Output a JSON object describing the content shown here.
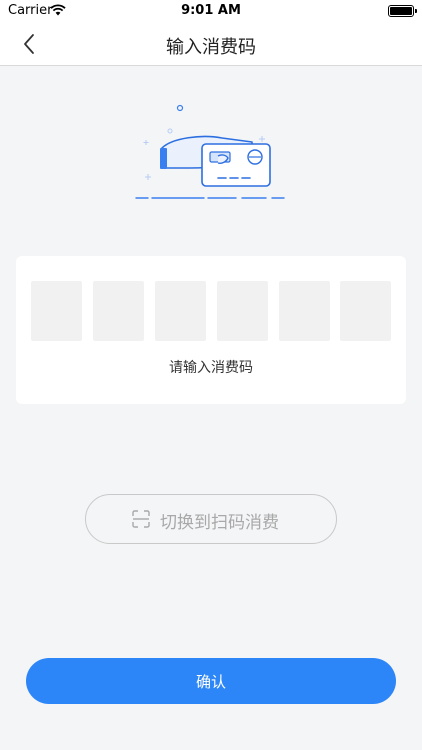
{
  "status_bar": {
    "carrier": "Carrier",
    "time": "9:01 AM"
  },
  "nav": {
    "title": "输入消费码",
    "back_icon": "chevron-left-icon"
  },
  "illustration_icon": "hand-holding-card-icon",
  "code_input": {
    "length": 6,
    "values": [
      "",
      "",
      "",
      "",
      "",
      ""
    ],
    "hint": "请输入消费码"
  },
  "switch_button": {
    "icon": "scan-icon",
    "label": "切换到扫码消费"
  },
  "confirm_button": {
    "label": "确认"
  },
  "colors": {
    "accent": "#2d86f7",
    "background": "#f4f5f7",
    "code_box": "#f1f1f1"
  }
}
